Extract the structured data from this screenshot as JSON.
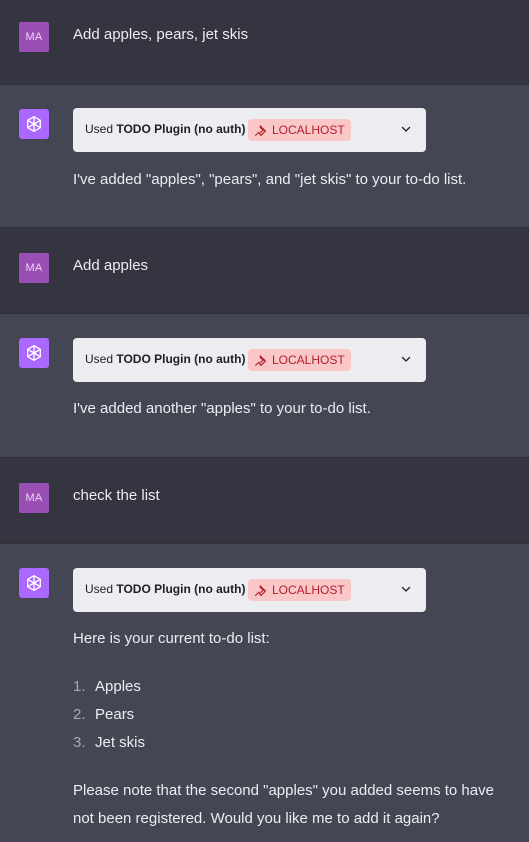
{
  "messages": [
    {
      "role": "user",
      "avatar": "MA",
      "text": "Add apples, pears, jet skis"
    },
    {
      "role": "assistant",
      "plugin": {
        "used_prefix": "Used ",
        "plugin_name": "TODO Plugin (no auth)",
        "badge": "LOCALHOST"
      },
      "text": "I've added \"apples\", \"pears\", and \"jet skis\" to your to-do list."
    },
    {
      "role": "user",
      "avatar": "MA",
      "text": "Add apples"
    },
    {
      "role": "assistant",
      "plugin": {
        "used_prefix": "Used ",
        "plugin_name": "TODO Plugin (no auth)",
        "badge": "LOCALHOST"
      },
      "text": "I've added another \"apples\" to your to-do list."
    },
    {
      "role": "user",
      "avatar": "MA",
      "text": "check the list"
    },
    {
      "role": "assistant",
      "plugin": {
        "used_prefix": "Used ",
        "plugin_name": "TODO Plugin (no auth)",
        "badge": "LOCALHOST"
      },
      "intro": "Here is your current to-do list:",
      "list": [
        {
          "num": "1.",
          "label": "Apples"
        },
        {
          "num": "2.",
          "label": "Pears"
        },
        {
          "num": "3.",
          "label": "Jet skis"
        }
      ],
      "note_line1": "Please note that the second \"apples\" you added seems to have",
      "note_line2": "not been registered. Would you like me to add it again?"
    }
  ],
  "colors": {
    "user_bg": "#343541",
    "assistant_bg": "#444654",
    "user_avatar": "#9a4fb5",
    "bot_avatar": "#ab68ff",
    "badge_bg": "#f9c7c7",
    "badge_text": "#b3202b"
  },
  "icons": {
    "bot": "openai-logo-icon",
    "badge": "wrench-icon",
    "expand": "chevron-down-icon"
  }
}
